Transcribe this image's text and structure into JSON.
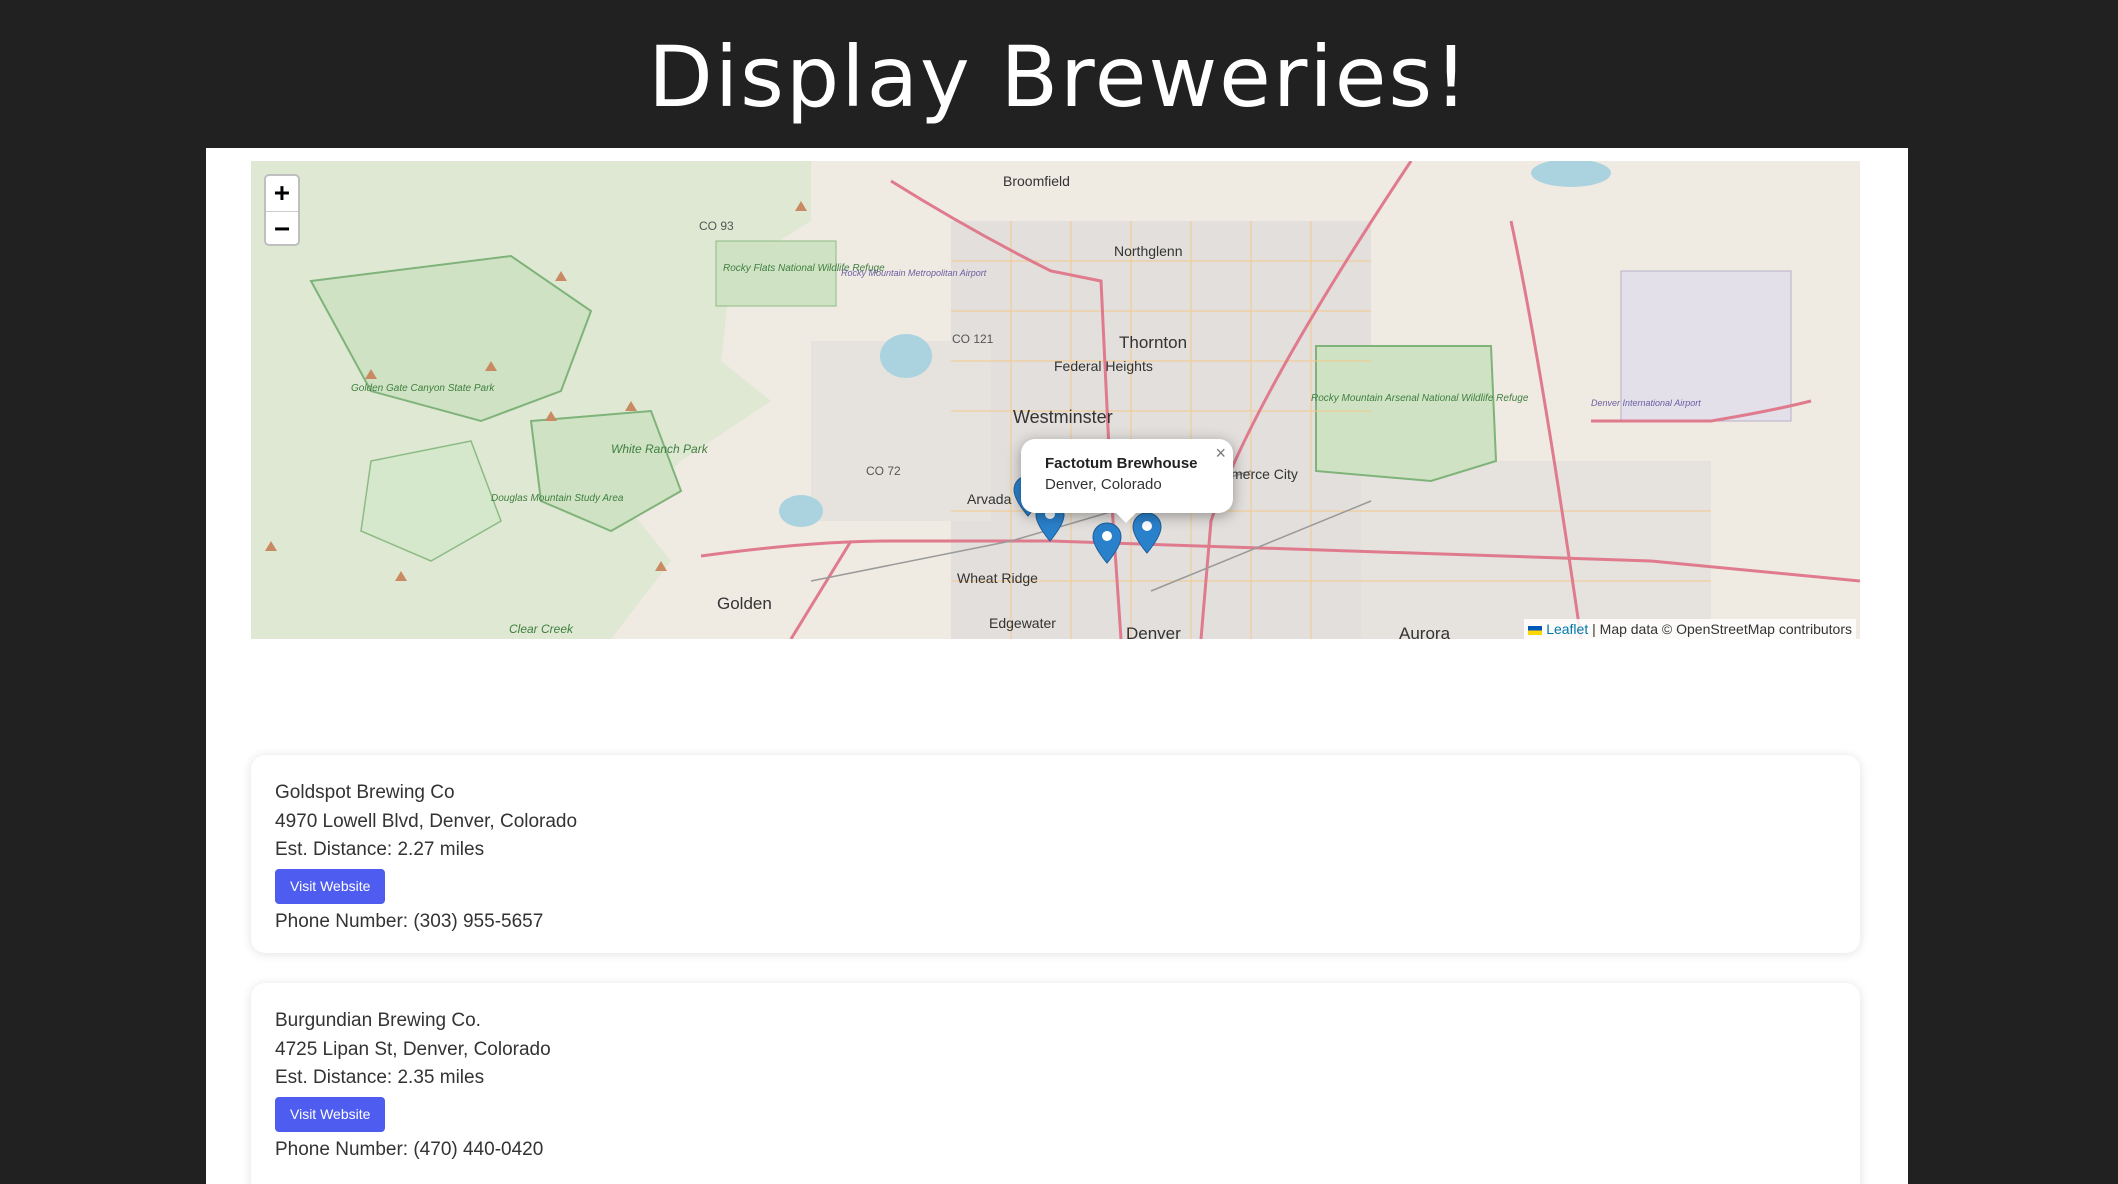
{
  "header": {
    "title": "Display Breweries!"
  },
  "map": {
    "zoom_in": "+",
    "zoom_out": "−",
    "popup": {
      "title": "Factotum Brewhouse",
      "subtitle": "Denver, Colorado",
      "close": "×"
    },
    "attribution": {
      "leaflet": "Leaflet",
      "rest": "| Map data © OpenStreetMap contributors"
    },
    "labels": {
      "broomfield": "Broomfield",
      "northglenn": "Northglenn",
      "thornton": "Thornton",
      "federal_heights": "Federal Heights",
      "westminster": "Westminster",
      "arvada": "Arvada",
      "wheat_ridge": "Wheat Ridge",
      "golden": "Golden",
      "edgewater": "Edgewater",
      "denver": "Denver",
      "aurora": "Aurora",
      "commerce_city": "merce City",
      "co93": "CO 93",
      "co121": "CO 121",
      "co72": "CO 72",
      "rocky_flats": "Rocky Flats National Wildlife Refuge",
      "rocky_mountain_airport": "Rocky Mountain Metropolitan Airport",
      "golden_gate": "Golden Gate Canyon State Park",
      "white_ranch": "White Ranch Park",
      "douglas_mountain": "Douglas Mountain Study Area",
      "rocky_mountain_arsenal": "Rocky Mountain Arsenal National Wildlife Refuge",
      "denver_airport": "Denver International Airport",
      "clear_creek": "Clear Creek"
    },
    "accent_color": "#2a81cb"
  },
  "breweries": [
    {
      "name": "Goldspot Brewing Co",
      "address": "4970 Lowell Blvd, Denver, Colorado",
      "distance": "Est. Distance: 2.27 miles",
      "button": "Visit Website",
      "phone": "Phone Number: (303) 955-5657"
    },
    {
      "name": "Burgundian Brewing Co.",
      "address": "4725 Lipan St, Denver, Colorado",
      "distance": "Est. Distance: 2.35 miles",
      "button": "Visit Website",
      "phone": "Phone Number: (470) 440-0420"
    }
  ],
  "colors": {
    "background": "#212121",
    "button": "#4f5cf0",
    "marker": "#2a81cb"
  }
}
